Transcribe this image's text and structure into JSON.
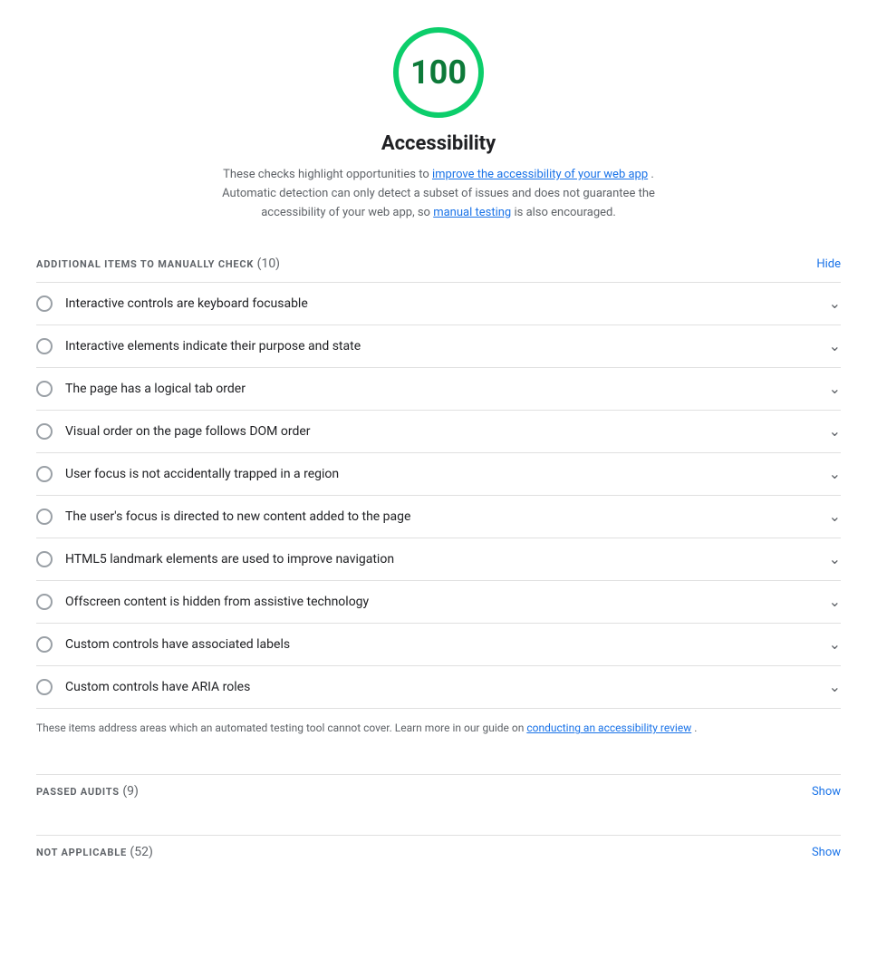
{
  "score": {
    "value": "100",
    "color": "#0cce6b",
    "text_color": "#0d7a39"
  },
  "title": "Accessibility",
  "description": {
    "prefix": "These checks highlight opportunities to ",
    "link1_text": "improve the accessibility of your web app",
    "link1_href": "#",
    "middle": ". Automatic detection can only detect a subset of issues and does not guarantee the accessibility of your web app, so ",
    "link2_text": "manual testing",
    "link2_href": "#",
    "suffix": " is also encouraged."
  },
  "manual_section": {
    "label": "ADDITIONAL ITEMS TO MANUALLY CHECK",
    "count": "(10)",
    "hide_label": "Hide",
    "items": [
      {
        "id": 1,
        "text": "Interactive controls are keyboard focusable"
      },
      {
        "id": 2,
        "text": "Interactive elements indicate their purpose and state"
      },
      {
        "id": 3,
        "text": "The page has a logical tab order"
      },
      {
        "id": 4,
        "text": "Visual order on the page follows DOM order"
      },
      {
        "id": 5,
        "text": "User focus is not accidentally trapped in a region"
      },
      {
        "id": 6,
        "text": "The user's focus is directed to new content added to the page"
      },
      {
        "id": 7,
        "text": "HTML5 landmark elements are used to improve navigation"
      },
      {
        "id": 8,
        "text": "Offscreen content is hidden from assistive technology"
      },
      {
        "id": 9,
        "text": "Custom controls have associated labels"
      },
      {
        "id": 10,
        "text": "Custom controls have ARIA roles"
      }
    ],
    "footer_prefix": "These items address areas which an automated testing tool cannot cover. Learn more in our guide on ",
    "footer_link_text": "conducting an accessibility review",
    "footer_link_href": "#",
    "footer_suffix": "."
  },
  "passed_section": {
    "label": "PASSED AUDITS",
    "count": "(9)",
    "show_label": "Show"
  },
  "not_applicable_section": {
    "label": "NOT APPLICABLE",
    "count": "(52)",
    "show_label": "Show"
  }
}
